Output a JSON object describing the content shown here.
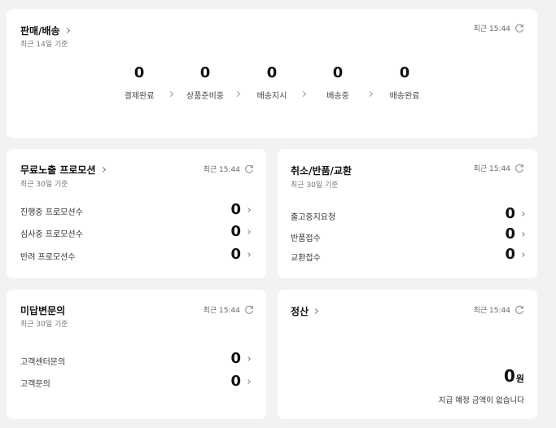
{
  "refresh_icon": "refresh-icon",
  "sales": {
    "title": "판매/배송",
    "subtitle": "최근 14일 기준",
    "time": "최근 15:44",
    "stats": [
      {
        "label": "결제완료",
        "value": "0"
      },
      {
        "label": "상품준비중",
        "value": "0"
      },
      {
        "label": "배송지시",
        "value": "0"
      },
      {
        "label": "배송중",
        "value": "0"
      },
      {
        "label": "배송완료",
        "value": "0"
      }
    ]
  },
  "promotion": {
    "title": "무료노출 프로모션",
    "subtitle": "최근 30일 기준",
    "time": "최근 15:44",
    "rows": [
      {
        "label": "진행중 프로모션수",
        "value": "0"
      },
      {
        "label": "심사중 프로모션수",
        "value": "0"
      },
      {
        "label": "반려 프로모션수",
        "value": "0"
      }
    ]
  },
  "claims": {
    "title": "취소/반품/교환",
    "subtitle": "최근 30일 기준",
    "time": "최근 15:44",
    "rows": [
      {
        "label": "출고중지요청",
        "value": "0"
      },
      {
        "label": "반품접수",
        "value": "0"
      },
      {
        "label": "교환접수",
        "value": "0"
      }
    ]
  },
  "inquiries": {
    "title": "미답변문의",
    "subtitle": "최근 30일 기준",
    "time": "최근 15:44",
    "rows": [
      {
        "label": "고객센터문의",
        "value": "0"
      },
      {
        "label": "고객문의",
        "value": "0"
      }
    ]
  },
  "settlement": {
    "title": "정산",
    "time": "최근 15:44",
    "amount": "0",
    "unit": "원",
    "note": "지급 예정 금액이 없습니다"
  }
}
